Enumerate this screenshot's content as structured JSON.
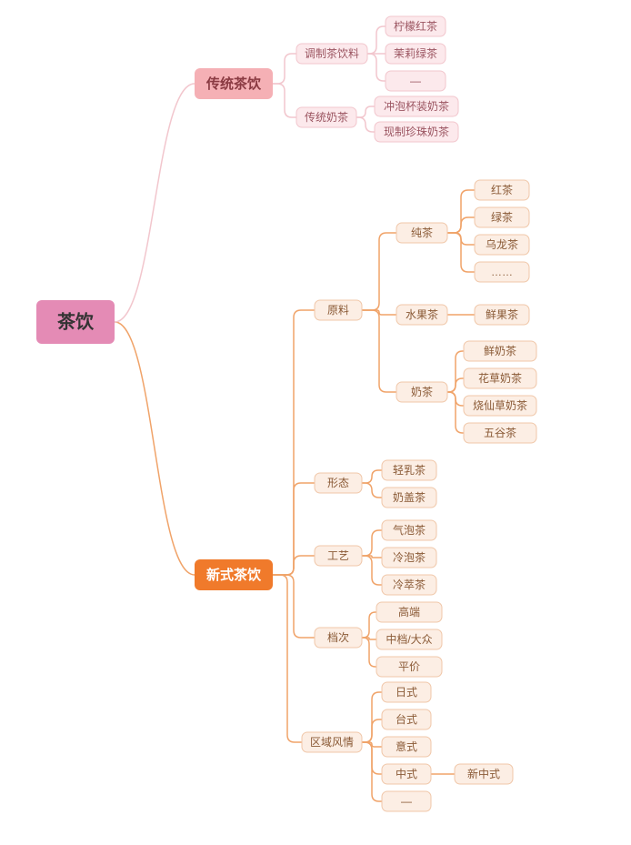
{
  "chart_data": {
    "type": "tree",
    "title": "",
    "root": {
      "label": "茶饮",
      "children": [
        {
          "label": "传统茶饮",
          "color": "pink",
          "children": [
            {
              "label": "调制茶饮料",
              "color": "pink",
              "children": [
                {
                  "label": "柠檬红茶",
                  "color": "pink"
                },
                {
                  "label": "茉莉绿茶",
                  "color": "pink"
                },
                {
                  "label": "—",
                  "color": "pink"
                }
              ]
            },
            {
              "label": "传统奶茶",
              "color": "pink",
              "children": [
                {
                  "label": "冲泡杯装奶茶",
                  "color": "pink"
                },
                {
                  "label": "现制珍珠奶茶",
                  "color": "pink"
                }
              ]
            }
          ]
        },
        {
          "label": "新式茶饮",
          "color": "orange",
          "children": [
            {
              "label": "原料",
              "color": "orange",
              "children": [
                {
                  "label": "纯茶",
                  "color": "orange",
                  "children": [
                    {
                      "label": "红茶",
                      "color": "orange"
                    },
                    {
                      "label": "绿茶",
                      "color": "orange"
                    },
                    {
                      "label": "乌龙茶",
                      "color": "orange"
                    },
                    {
                      "label": "……",
                      "color": "orange"
                    }
                  ]
                },
                {
                  "label": "水果茶",
                  "color": "orange",
                  "children": [
                    {
                      "label": "鲜果茶",
                      "color": "orange"
                    }
                  ]
                },
                {
                  "label": "奶茶",
                  "color": "orange",
                  "children": [
                    {
                      "label": "鲜奶茶",
                      "color": "orange"
                    },
                    {
                      "label": "花草奶茶",
                      "color": "orange"
                    },
                    {
                      "label": "烧仙草奶茶",
                      "color": "orange"
                    },
                    {
                      "label": "五谷茶",
                      "color": "orange"
                    }
                  ]
                }
              ]
            },
            {
              "label": "形态",
              "color": "orange",
              "children": [
                {
                  "label": "轻乳茶",
                  "color": "orange"
                },
                {
                  "label": "奶盖茶",
                  "color": "orange"
                }
              ]
            },
            {
              "label": "工艺",
              "color": "orange",
              "children": [
                {
                  "label": "气泡茶",
                  "color": "orange"
                },
                {
                  "label": "冷泡茶",
                  "color": "orange"
                },
                {
                  "label": "冷萃茶",
                  "color": "orange"
                }
              ]
            },
            {
              "label": "档次",
              "color": "orange",
              "children": [
                {
                  "label": "高端",
                  "color": "orange"
                },
                {
                  "label": "中档/大众",
                  "color": "orange"
                },
                {
                  "label": "平价",
                  "color": "orange"
                }
              ]
            },
            {
              "label": "区域风情",
              "color": "orange",
              "children": [
                {
                  "label": "日式",
                  "color": "orange"
                },
                {
                  "label": "台式",
                  "color": "orange"
                },
                {
                  "label": "意式",
                  "color": "orange"
                },
                {
                  "label": "中式",
                  "color": "orange",
                  "children": [
                    {
                      "label": "新中式",
                      "color": "orange"
                    }
                  ]
                },
                {
                  "label": "—",
                  "color": "orange"
                }
              ]
            }
          ]
        }
      ]
    }
  },
  "layout": {
    "node_radius": 6,
    "edge_radius": 10
  }
}
